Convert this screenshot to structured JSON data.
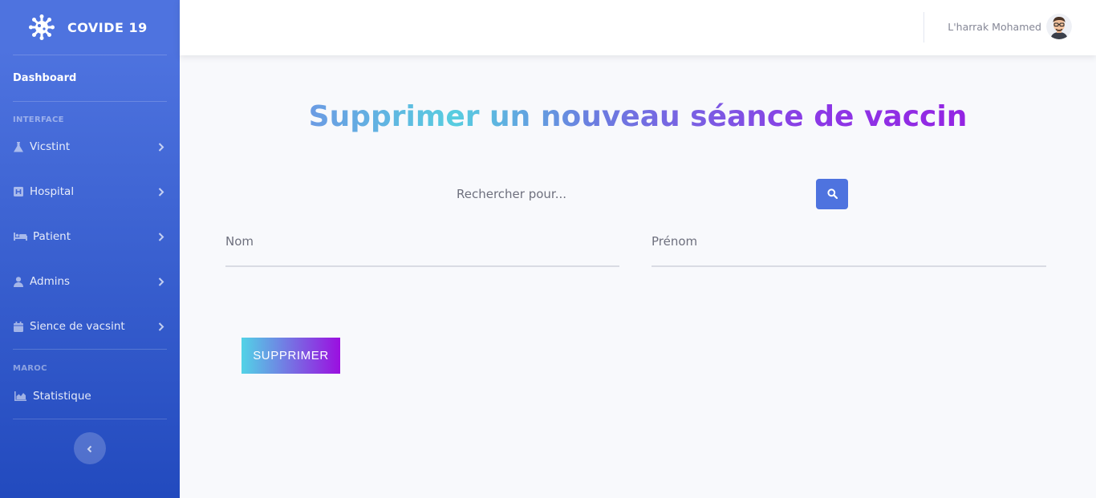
{
  "sidebar": {
    "brand": {
      "name": "COVIDE 19",
      "icon": "virus-icon"
    },
    "dashboard_label": "Dashboard",
    "headings": [
      "INTERFACE",
      "MAROC"
    ],
    "items": [
      {
        "label": "Vicstint",
        "icon": "flask-icon"
      },
      {
        "label": "Hospital",
        "icon": "hospital-icon"
      },
      {
        "label": "Patient",
        "icon": "bed-icon"
      },
      {
        "label": "Admins",
        "icon": "user-md-icon"
      },
      {
        "label": "Sience de vacsint",
        "icon": "calendar-icon"
      }
    ],
    "stats_item": {
      "label": "Statistique",
      "icon": "area-chart-icon"
    },
    "toggle_icon": "chevron-left-icon"
  },
  "topbar": {
    "user_name": "L'harrak Mohamed",
    "avatar_icon": "avatar"
  },
  "main": {
    "title": "Supprimer un nouveau séance de vaccin",
    "search": {
      "placeholder": "Rechercher pour...",
      "value": "",
      "icon": "search-icon"
    },
    "fields": {
      "nom": {
        "placeholder": "Nom",
        "value": ""
      },
      "prenom": {
        "placeholder": "Prénom",
        "value": ""
      }
    },
    "submit_label": "SUPPRIMER"
  },
  "colors": {
    "sidebar_top": "#4e73df",
    "sidebar_bottom": "#224abe",
    "primary": "#4e73df",
    "button_gradient_start": "#52d3e6",
    "button_gradient_end": "#9b0fe0",
    "background": "#f8f9fc"
  }
}
